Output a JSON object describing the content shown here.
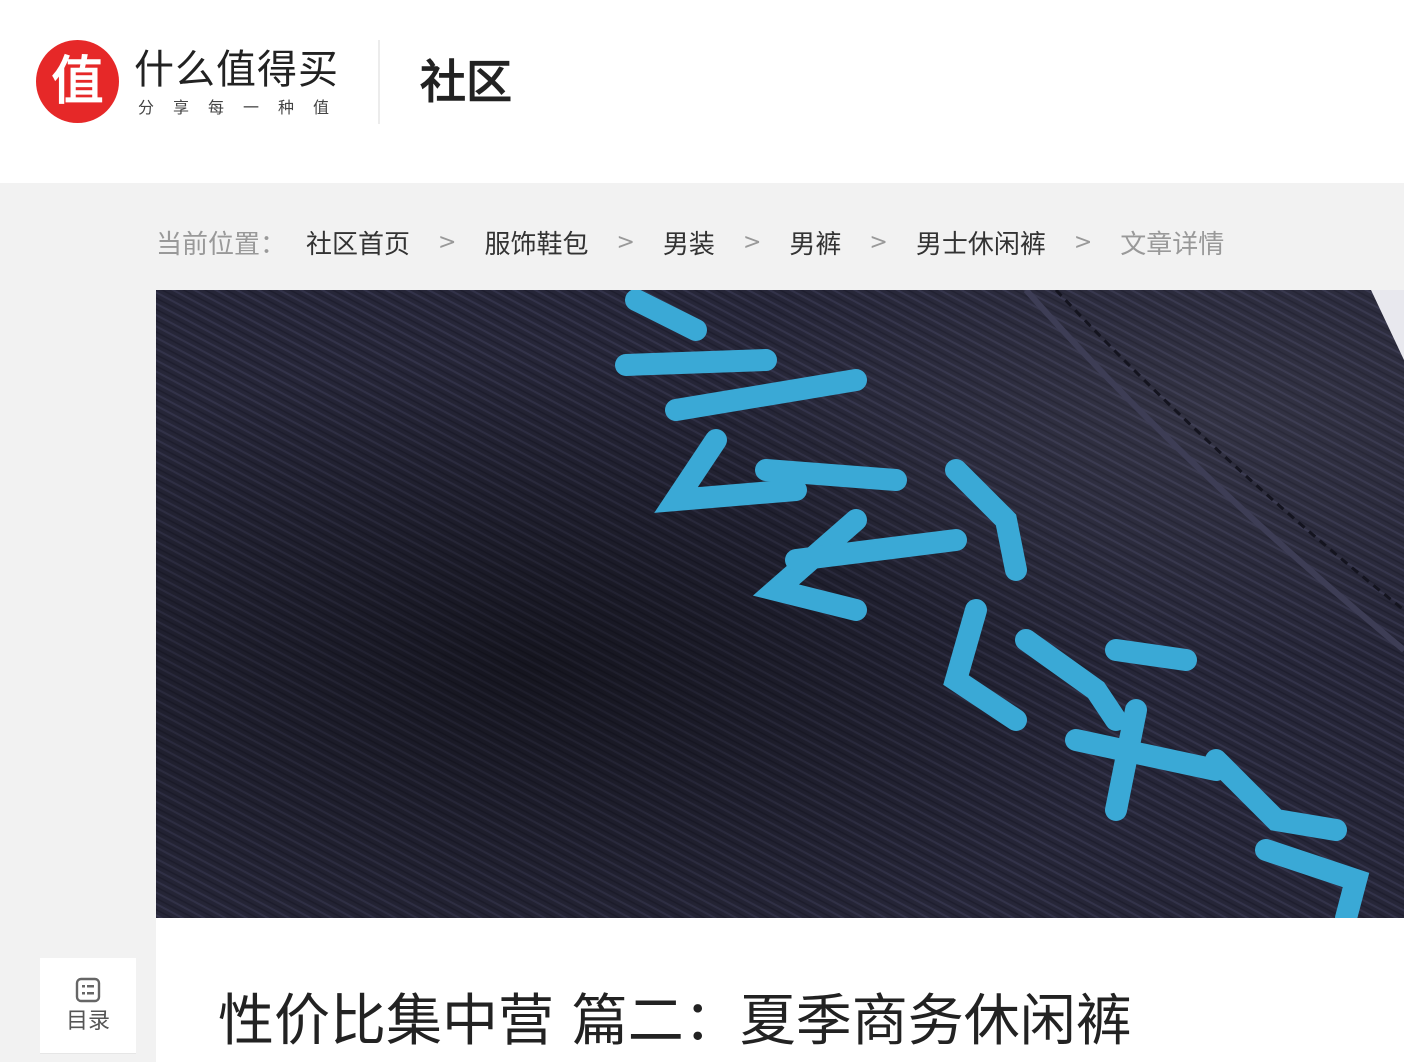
{
  "header": {
    "logo_char": "值",
    "logo_title": "什么值得买",
    "logo_slogan": "分享每一种值",
    "section": "社区"
  },
  "breadcrumb": {
    "label": "当前位置：",
    "separator": ">",
    "items": [
      "社区首页",
      "服饰鞋包",
      "男装",
      "男裤",
      "男士休闲裤"
    ],
    "current": "文章详情"
  },
  "article": {
    "title": "性价比集中营 篇二：夏季商务休闲裤"
  },
  "toc": {
    "label": "目录"
  },
  "colors": {
    "brand": "#e62828",
    "fabric": "#262638",
    "embroidery": "#3aa9d6"
  }
}
